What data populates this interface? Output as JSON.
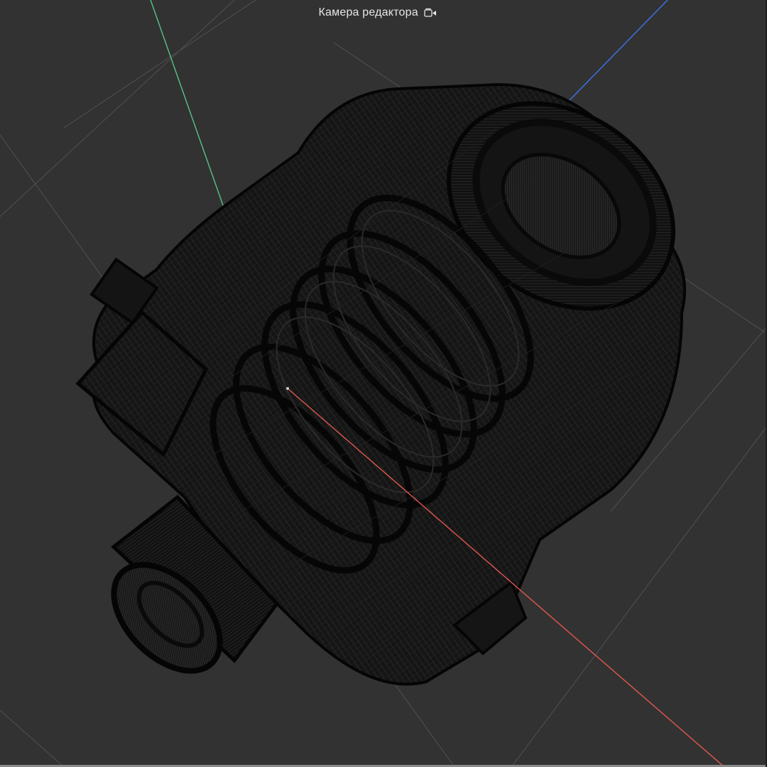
{
  "viewport": {
    "camera_label": "Камера редактора",
    "camera_icon": "camera-lock-icon",
    "background_color": "#323232",
    "grid_color": "#555555",
    "axis_colors": {
      "x": "#e0574f",
      "y": "#55c28a",
      "z": "#3a6fd8"
    },
    "model_display": "wireframe",
    "model_color": "#0d0d0d"
  }
}
